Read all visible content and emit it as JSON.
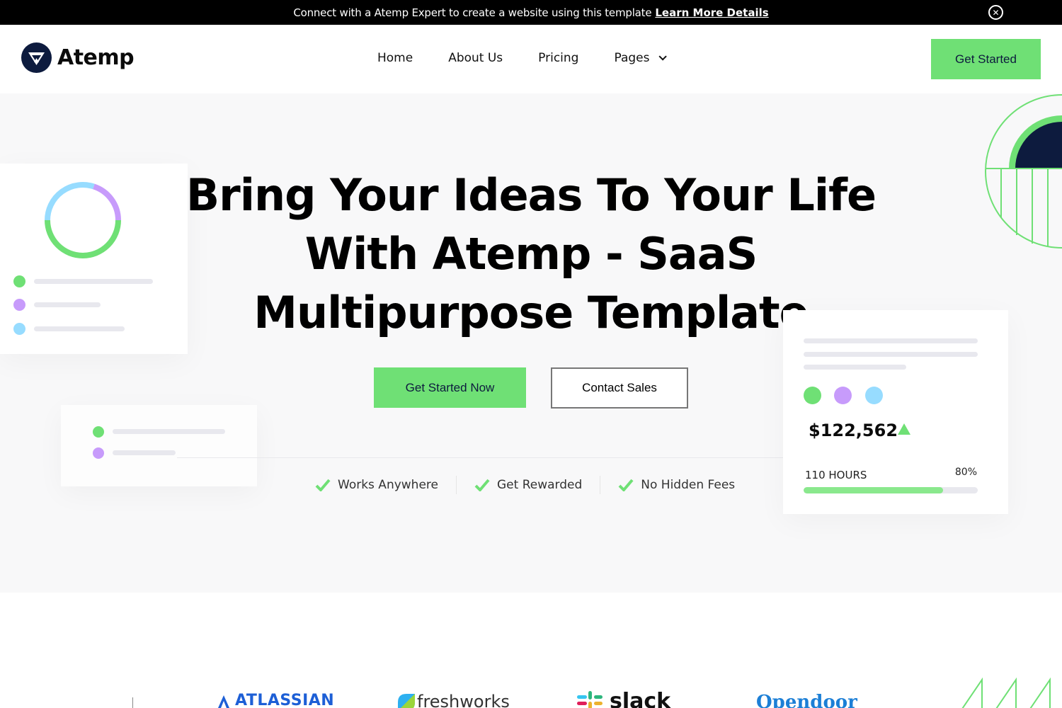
{
  "announcement": {
    "message": "Connect with a Atemp Expert to create a website using this template",
    "link_label": "Learn More Details",
    "close_icon": "close-circle-icon"
  },
  "header": {
    "logo_text": "Atemp",
    "logo_icon": "atemp-logo-icon",
    "nav": [
      {
        "label": "Home"
      },
      {
        "label": "About Us"
      },
      {
        "label": "Pricing"
      },
      {
        "label": "Pages",
        "icon": "chevron-down-icon"
      }
    ],
    "cta_label": "Get Started"
  },
  "hero": {
    "headline": "Bring Your Ideas To Your Life With Atemp - SaaS Multipurpose Template",
    "primary_button": "Get Started Now",
    "secondary_button": "Contact Sales",
    "features": [
      {
        "label": "Works Anywhere",
        "icon": "check-icon"
      },
      {
        "label": "Get Rewarded",
        "icon": "check-icon"
      },
      {
        "label": "No Hidden Fees",
        "icon": "check-icon"
      }
    ],
    "stats_card": {
      "amount": "$122,562",
      "trend_icon": "triangle-up-icon",
      "hours_label": "110 HOURS",
      "percent_label": "80%",
      "progress": 0.8
    },
    "donut": {
      "segments": [
        {
          "color": "#6fe075",
          "share": 0.5
        },
        {
          "color": "#97dcff",
          "share": 0.3
        },
        {
          "color": "#c79bfb",
          "share": 0.2
        }
      ]
    },
    "colors": {
      "accent_green": "#6fe075",
      "purple": "#c79bfb",
      "light_blue": "#97dcff",
      "navy": "#0d1b3e"
    }
  },
  "logos": [
    {
      "name": "ATLASSIAN"
    },
    {
      "name": "freshworks"
    },
    {
      "name": "slack"
    },
    {
      "name": "Opendoor"
    }
  ]
}
